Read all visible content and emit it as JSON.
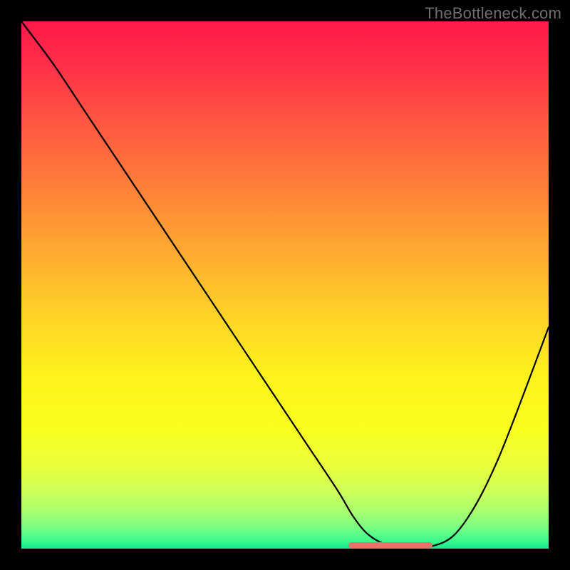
{
  "watermark": "TheBottleneck.com",
  "chart_data": {
    "type": "line",
    "title": "",
    "xlabel": "",
    "ylabel": "",
    "xlim": [
      0,
      100
    ],
    "ylim": [
      0,
      100
    ],
    "grid": false,
    "series": [
      {
        "name": "curve",
        "x": [
          0,
          6,
          12,
          18,
          24,
          30,
          36,
          42,
          48,
          54,
          60,
          63,
          66,
          70,
          74,
          78,
          82,
          86,
          90,
          94,
          100
        ],
        "y": [
          100,
          92,
          83,
          74,
          65,
          56,
          47,
          38,
          29,
          20,
          11,
          6,
          2.5,
          0.5,
          0.3,
          0.5,
          2.5,
          8,
          16,
          26,
          42
        ]
      }
    ],
    "marker": {
      "name": "highlight-segment",
      "x_start": 62,
      "x_end": 78,
      "y": 0.5,
      "color": "#e2766b"
    },
    "background_gradient": {
      "stops": [
        {
          "pos": 0.0,
          "color": "#ff1a4a"
        },
        {
          "pos": 0.07,
          "color": "#ff2a49"
        },
        {
          "pos": 0.18,
          "color": "#ff5342"
        },
        {
          "pos": 0.3,
          "color": "#ff7a3a"
        },
        {
          "pos": 0.42,
          "color": "#ffa432"
        },
        {
          "pos": 0.55,
          "color": "#ffd028"
        },
        {
          "pos": 0.67,
          "color": "#fff21c"
        },
        {
          "pos": 0.78,
          "color": "#f8ff20"
        },
        {
          "pos": 0.84,
          "color": "#eaff3a"
        },
        {
          "pos": 0.89,
          "color": "#cfff58"
        },
        {
          "pos": 0.93,
          "color": "#a8ff70"
        },
        {
          "pos": 0.96,
          "color": "#78ff82"
        },
        {
          "pos": 0.985,
          "color": "#3cf98c"
        },
        {
          "pos": 1.0,
          "color": "#12e88e"
        }
      ]
    }
  }
}
